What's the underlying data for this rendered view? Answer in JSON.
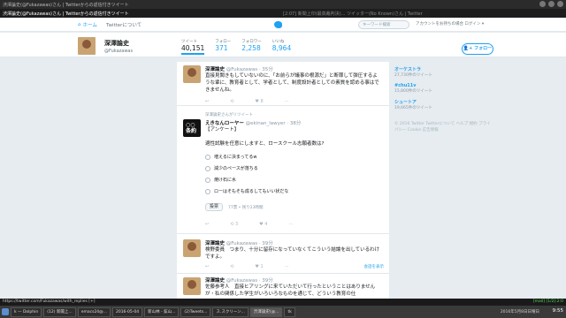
{
  "wm": {
    "left": "渋澤論史(@Fukazawas)さん | Twitterからの返信付きツイート",
    "center": "渋澤論史(@Fukazawas)さん | Twitterからの返信付きツイート - h..."
  },
  "tab": {
    "t1": "渋澤論史(@Fukazawas)さん | Twitterからの返信付きツイート",
    "t2": "[2:07] 新聞上印(最高裁判決)... ツイッター(No Known)さん | Twitter"
  },
  "nav": {
    "home": "ホーム",
    "about": "Twitterについて",
    "search_placeholder": "キーワード検索",
    "login": "アカウントをお持ちの場合 ログイン ▾"
  },
  "profile": {
    "name": "深澤論史",
    "handle": "@Fukazawas",
    "stats": [
      {
        "label": "ツイート",
        "value": "40,151"
      },
      {
        "label": "フォロー",
        "value": "371"
      },
      {
        "label": "フォロワー",
        "value": "2,258"
      },
      {
        "label": "いいね",
        "value": "8,964"
      }
    ],
    "follow_label": "フォロー"
  },
  "tweets": [
    {
      "author": "深澤論史",
      "handle": "@Fukazawas · 35分",
      "text": "直接見聞きもしていないのに、「お前らが議事の根源だ」と断罪して弾圧するような輩に、教育者として、学者として、制度設計者としての素質を認める事はできませんね。",
      "actions": [
        "↩",
        "⟲",
        "♥ 8",
        "···"
      ]
    },
    {
      "rt_note": "深澤論史さんがリツイート",
      "author": "えきなんローヤー",
      "handle": "@ekinan_lawyer · 38分",
      "text": "【アンケート】\n\n適性試験を任意にしますと、ロースクール志願者数は?",
      "poll": [
        "増えるに決まってるw",
        "減少のペースが落ちる",
        "焼け石に水",
        "ローはそもそも成るしてもいい状だな"
      ],
      "vote_label": "投票",
      "vote_meta": "77票 • 残り23時間",
      "actions": [
        "↩",
        "⟲ 3",
        "♥ 4",
        "···"
      ]
    },
    {
      "author": "深澤論史",
      "handle": "@Fukazawas · 39分",
      "text": "検野委員　つまり、十分に留存になっていなくてこういう結論を出しているわけですよ。",
      "actions": [
        "↩",
        "⟲",
        "♥ 1",
        "···"
      ],
      "show_conv": "会話を表示"
    },
    {
      "author": "深澤論史",
      "handle": "@Fukazawas · 39分",
      "text": "佐藤参考人　直接ヒアリングに来ていただいて行ったということはありませんが・私の関係した学生がいろいろなものを通じて、どういう教育の仕",
      "actions": []
    }
  ],
  "sidebar": [
    {
      "name": "オーケストラ",
      "count": "27,730件のツイート"
    },
    {
      "name": "#chu11v",
      "count": "15,800件のツイート"
    },
    {
      "name": "シュートア",
      "count": "19,665件のツイート"
    }
  ],
  "footer": "© 2016 Twitter  Twitterについて  ヘルプ  規約  プライバシー  Cookie  広告情報",
  "status": {
    "left": "https://twitter.com/Fukazawas/with_replies [+]",
    "right": "[mail] [1/2]:2:0"
  },
  "taskbar": {
    "tasks": [
      "k — Dolphin",
      "(12) 新聞上... ",
      "emacs24@...",
      "2016-05-04",
      "新山林 - 鉱山...",
      "(2)Tweets...",
      "ス.スクリーン...",
      "渋澤論史(@...",
      "tk"
    ],
    "date": "2016年5月8日日曜日",
    "clock": "9:55"
  }
}
